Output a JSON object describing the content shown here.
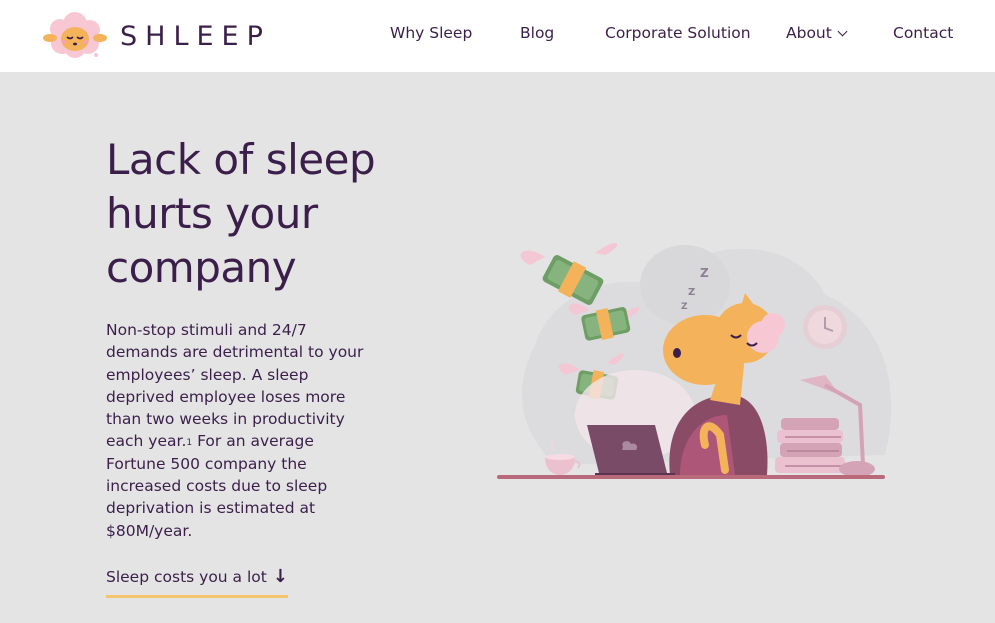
{
  "brand": {
    "name": "SHLEEP"
  },
  "nav": {
    "items": [
      {
        "label": "Why Sleep"
      },
      {
        "label": "Blog"
      },
      {
        "label": "Corporate Solution"
      },
      {
        "label": "About"
      },
      {
        "label": "Contact"
      }
    ]
  },
  "hero": {
    "title": "Lack of sleep hurts your company",
    "body_part1": "Non-stop stimuli and 24/7 demands are detrimental to your employees’ sleep. A sleep deprived employee loses more than two weeks in productivity each year.",
    "footnote": "1",
    "body_part2": " For an average Fortune 500 company the increased costs due to sleep deprivation is estimated at $80M/year.",
    "cta_label": "Sleep costs you a lot",
    "cta_arrow": "↓"
  },
  "colors": {
    "brand_purple": "#3b1f4a",
    "accent_yellow": "#f4c46f",
    "background": "#e4e4e5",
    "nav_bg": "#ffffff"
  },
  "icons": {
    "logo": "sheep-logo-icon",
    "dropdown": "chevron-down-icon",
    "cta": "arrow-down-icon"
  }
}
